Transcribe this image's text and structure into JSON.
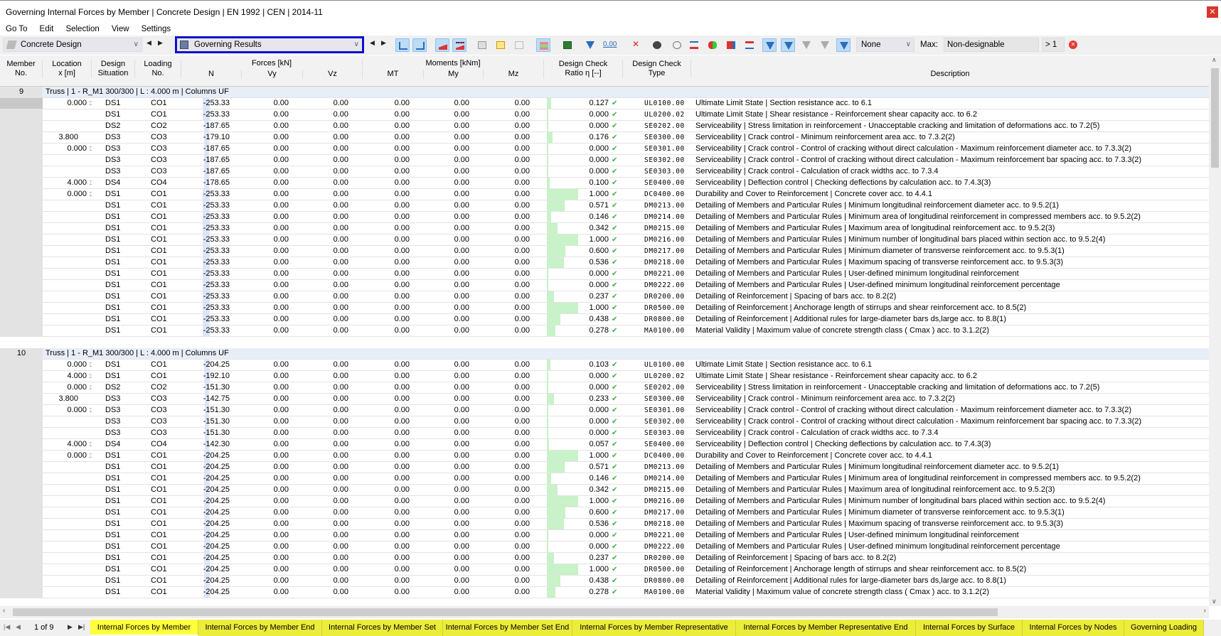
{
  "window": {
    "title": "Governing Internal Forces by Member | Concrete Design | EN 1992 | CEN | 2014-11",
    "close_icon": "close-icon"
  },
  "menu": [
    "Go To",
    "Edit",
    "Selection",
    "View",
    "Settings"
  ],
  "toolbar": {
    "module": "Concrete Design",
    "result_type": "Governing Results",
    "filter_select": "None",
    "max_label": "Max:",
    "max_value": "Non-designable",
    "gt_value": "> 1"
  },
  "headers": {
    "member": "Member\nNo.",
    "location": "Location\nx [m]",
    "design_situation": "Design\nSituation",
    "loading": "Loading\nNo.",
    "forces_group": "Forces [kN]",
    "n": "N",
    "vy": "Vy",
    "vz": "Vz",
    "moments_group": "Moments [kNm]",
    "mt": "MT",
    "my": "My",
    "mz": "Mz",
    "ratio": "Design Check\nRatio η [--]",
    "type": "Design Check\nType",
    "description": "Description"
  },
  "checks": [
    [
      "UL0100.00",
      "Ultimate Limit State | Section resistance acc. to 6.1"
    ],
    [
      "UL0200.02",
      "Ultimate Limit State | Shear resistance - Reinforcement shear capacity acc. to 6.2"
    ],
    [
      "SE0202.00",
      "Serviceability | Stress limitation in reinforcement - Unacceptable cracking and limitation of deformations acc. to 7.2(5)"
    ],
    [
      "SE0300.00",
      "Serviceability | Crack control - Minimum reinforcement area acc. to 7.3.2(2)"
    ],
    [
      "SE0301.00",
      "Serviceability | Crack control - Control of cracking without direct calculation - Maximum reinforcement diameter acc. to 7.3.3(2)"
    ],
    [
      "SE0302.00",
      "Serviceability | Crack control - Control of cracking without direct calculation - Maximum reinforcement bar spacing acc. to 7.3.3(2)"
    ],
    [
      "SE0303.00",
      "Serviceability | Crack control - Calculation of crack widths acc. to 7.3.4"
    ],
    [
      "SE0400.00",
      "Serviceability | Deflection control | Checking deflections by calculation acc. to 7.4.3(3)"
    ],
    [
      "DC0400.00",
      "Durability and Cover to Reinforcement | Concrete cover acc. to 4.4.1"
    ],
    [
      "DM0213.00",
      "Detailing of Members and Particular Rules | Minimum longitudinal reinforcement diameter acc. to 9.5.2(1)"
    ],
    [
      "DM0214.00",
      "Detailing of Members and Particular Rules | Minimum area of longitudinal reinforcement in compressed members acc. to 9.5.2(2)"
    ],
    [
      "DM0215.00",
      "Detailing of Members and Particular Rules | Maximum area of longitudinal reinforcement acc. to 9.5.2(3)"
    ],
    [
      "DM0216.00",
      "Detailing of Members and Particular Rules | Minimum number of longitudinal bars placed within section acc. to 9.5.2(4)"
    ],
    [
      "DM0217.00",
      "Detailing of Members and Particular Rules | Minimum diameter of transverse reinforcement acc. to 9.5.3(1)"
    ],
    [
      "DM0218.00",
      "Detailing of Members and Particular Rules | Maximum spacing of transverse reinforcement acc. to 9.5.3(3)"
    ],
    [
      "DM0221.00",
      "Detailing of Members and Particular Rules | User-defined minimum longitudinal reinforcement"
    ],
    [
      "DM0222.00",
      "Detailing of Members and Particular Rules | User-defined minimum longitudinal reinforcement percentage"
    ],
    [
      "DR0200.00",
      "Detailing of Reinforcement | Spacing of bars acc. to 8.2(2)"
    ],
    [
      "DR0500.00",
      "Detailing of Reinforcement | Anchorage length of stirrups and shear reinforcement acc. to 8.5(2)"
    ],
    [
      "DR0800.00",
      "Detailing of Reinforcement | Additional rules for large-diameter bars ds,large acc. to 8.8(1)"
    ],
    [
      "MA0100.00",
      "Material Validity | Maximum value of concrete strength class ( Cmax ) acc. to 3.1.2(2)"
    ]
  ],
  "members": [
    {
      "no": "9",
      "info": "Truss | 1 - R_M1 300/300 | L : 4.000 m | Columns UF",
      "zero": "0.00",
      "rows": [
        [
          "0.000",
          true,
          "DS1",
          "CO1",
          "-253.33",
          "0.127"
        ],
        [
          "",
          false,
          "DS1",
          "CO1",
          "-253.33",
          "0.000"
        ],
        [
          "",
          false,
          "DS2",
          "CO2",
          "-187.65",
          "0.000"
        ],
        [
          "3.800",
          false,
          "DS3",
          "CO3",
          "-179.10",
          "0.176"
        ],
        [
          "0.000",
          true,
          "DS3",
          "CO3",
          "-187.65",
          "0.000"
        ],
        [
          "",
          false,
          "DS3",
          "CO3",
          "-187.65",
          "0.000"
        ],
        [
          "",
          false,
          "DS3",
          "CO3",
          "-187.65",
          "0.000"
        ],
        [
          "4.000",
          true,
          "DS4",
          "CO4",
          "-178.65",
          "0.100"
        ],
        [
          "0.000",
          true,
          "DS1",
          "CO1",
          "-253.33",
          "1.000"
        ],
        [
          "",
          false,
          "DS1",
          "CO1",
          "-253.33",
          "0.571"
        ],
        [
          "",
          false,
          "DS1",
          "CO1",
          "-253.33",
          "0.146"
        ],
        [
          "",
          false,
          "DS1",
          "CO1",
          "-253.33",
          "0.342"
        ],
        [
          "",
          false,
          "DS1",
          "CO1",
          "-253.33",
          "1.000"
        ],
        [
          "",
          false,
          "DS1",
          "CO1",
          "-253.33",
          "0.600"
        ],
        [
          "",
          false,
          "DS1",
          "CO1",
          "-253.33",
          "0.536"
        ],
        [
          "",
          false,
          "DS1",
          "CO1",
          "-253.33",
          "0.000"
        ],
        [
          "",
          false,
          "DS1",
          "CO1",
          "-253.33",
          "0.000"
        ],
        [
          "",
          false,
          "DS1",
          "CO1",
          "-253.33",
          "0.237"
        ],
        [
          "",
          false,
          "DS1",
          "CO1",
          "-253.33",
          "1.000"
        ],
        [
          "",
          false,
          "DS1",
          "CO1",
          "-253.33",
          "0.438"
        ],
        [
          "",
          false,
          "DS1",
          "CO1",
          "-253.33",
          "0.278"
        ]
      ]
    },
    {
      "no": "10",
      "info": "Truss | 1 - R_M1 300/300 | L : 4.000 m | Columns UF",
      "zero": "0.00",
      "rows": [
        [
          "0.000",
          true,
          "DS1",
          "CO1",
          "-204.25",
          "0.103"
        ],
        [
          "4.000",
          true,
          "DS1",
          "CO1",
          "-192.10",
          "0.000"
        ],
        [
          "0.000",
          true,
          "DS2",
          "CO2",
          "-151.30",
          "0.000"
        ],
        [
          "3.800",
          false,
          "DS3",
          "CO3",
          "-142.75",
          "0.233"
        ],
        [
          "0.000",
          true,
          "DS3",
          "CO3",
          "-151.30",
          "0.000"
        ],
        [
          "",
          false,
          "DS3",
          "CO3",
          "-151.30",
          "0.000"
        ],
        [
          "",
          false,
          "DS3",
          "CO3",
          "-151.30",
          "0.000"
        ],
        [
          "4.000",
          true,
          "DS4",
          "CO4",
          "-142.30",
          "0.057"
        ],
        [
          "0.000",
          true,
          "DS1",
          "CO1",
          "-204.25",
          "1.000"
        ],
        [
          "",
          false,
          "DS1",
          "CO1",
          "-204.25",
          "0.571"
        ],
        [
          "",
          false,
          "DS1",
          "CO1",
          "-204.25",
          "0.146"
        ],
        [
          "",
          false,
          "DS1",
          "CO1",
          "-204.25",
          "0.342"
        ],
        [
          "",
          false,
          "DS1",
          "CO1",
          "-204.25",
          "1.000"
        ],
        [
          "",
          false,
          "DS1",
          "CO1",
          "-204.25",
          "0.600"
        ],
        [
          "",
          false,
          "DS1",
          "CO1",
          "-204.25",
          "0.536"
        ],
        [
          "",
          false,
          "DS1",
          "CO1",
          "-204.25",
          "0.000"
        ],
        [
          "",
          false,
          "DS1",
          "CO1",
          "-204.25",
          "0.000"
        ],
        [
          "",
          false,
          "DS1",
          "CO1",
          "-204.25",
          "0.237"
        ],
        [
          "",
          false,
          "DS1",
          "CO1",
          "-204.25",
          "1.000"
        ],
        [
          "",
          false,
          "DS1",
          "CO1",
          "-204.25",
          "0.438"
        ],
        [
          "",
          false,
          "DS1",
          "CO1",
          "-204.25",
          "0.278"
        ]
      ]
    }
  ],
  "pager": "1 of 9",
  "tabs": [
    "Internal Forces by Member",
    "Internal Forces by Member End",
    "Internal Forces by Member Set",
    "Internal Forces by Member Set End",
    "Internal Forces by Member Representative",
    "Internal Forces by Member Representative End",
    "Internal Forces by Surface",
    "Internal Forces by Nodes",
    "Governing Loading"
  ],
  "active_tab": 0,
  "colors": {
    "ratio_bar": "#c8f2c8",
    "check": "#3cb043",
    "highlight_border": "#1010d0",
    "tabs": "#ecec3a",
    "active_tab": "#ffff3c",
    "group_row": "#e8eef8"
  }
}
